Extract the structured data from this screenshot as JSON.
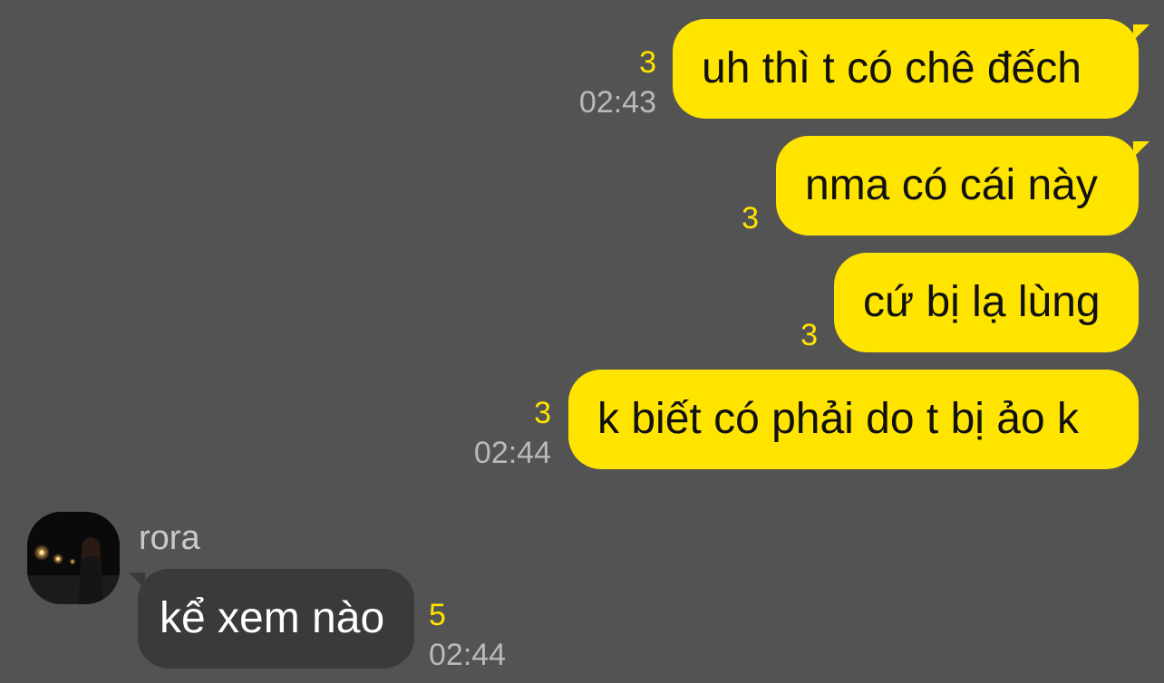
{
  "messages_outgoing": [
    {
      "text": "uh thì t có chê đếch",
      "unread": "3",
      "time": "02:43"
    },
    {
      "text": "nma có cái này",
      "unread": "3",
      "time": ""
    },
    {
      "text": "cứ bị lạ lùng",
      "unread": "3",
      "time": ""
    },
    {
      "text": "k biết có phải do t bị ảo k",
      "unread": "3",
      "time": "02:44"
    }
  ],
  "message_incoming": {
    "sender": "rora",
    "text": "kể xem nào",
    "unread": "5",
    "time": "02:44"
  },
  "colors": {
    "background": "#545354",
    "outgoing_bubble": "#FFE400",
    "incoming_bubble": "#3A3A3C",
    "unread_count": "#FFE400",
    "timestamp": "#B9B9B9"
  }
}
